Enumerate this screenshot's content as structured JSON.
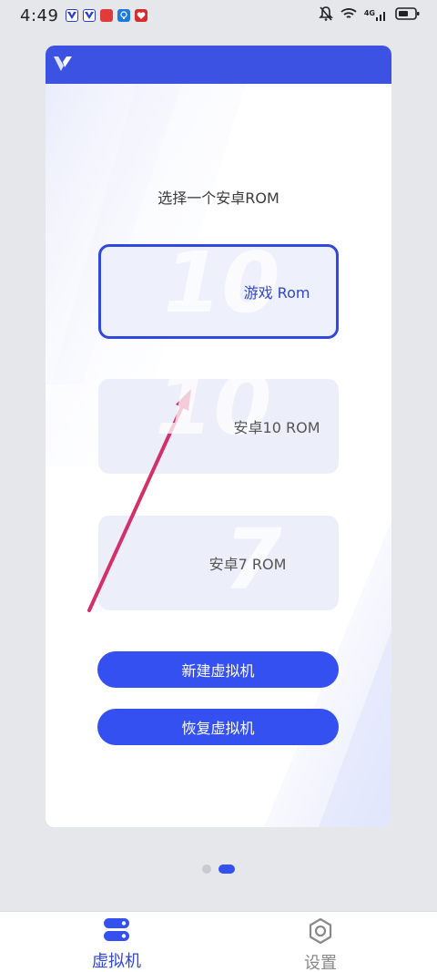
{
  "status_bar": {
    "time": "4:49",
    "network": "4G",
    "icons": [
      "vivo-app-icon",
      "vivo-app-icon",
      "red-app-icon",
      "bulb-app-icon",
      "red-app-icon",
      "mute-icon",
      "wifi-icon",
      "signal-icon",
      "battery-icon"
    ]
  },
  "card": {
    "prompt": "选择一个安卓ROM",
    "roms": [
      {
        "label": "游戏 Rom",
        "watermark": "10",
        "selected": true
      },
      {
        "label": "安卓10 ROM",
        "watermark": "10",
        "selected": false
      },
      {
        "label": "安卓7 ROM",
        "watermark": "7",
        "selected": false
      }
    ],
    "new_vm_button": "新建虚拟机",
    "restore_vm_button": "恢复虚拟机"
  },
  "pagination": {
    "total": 2,
    "current": 2
  },
  "bottom_nav": {
    "vm_label": "虚拟机",
    "settings_label": "设置"
  },
  "colors": {
    "accent": "#3450f0",
    "header": "#3b52e3",
    "annotation_arrow": "#d3306a"
  }
}
